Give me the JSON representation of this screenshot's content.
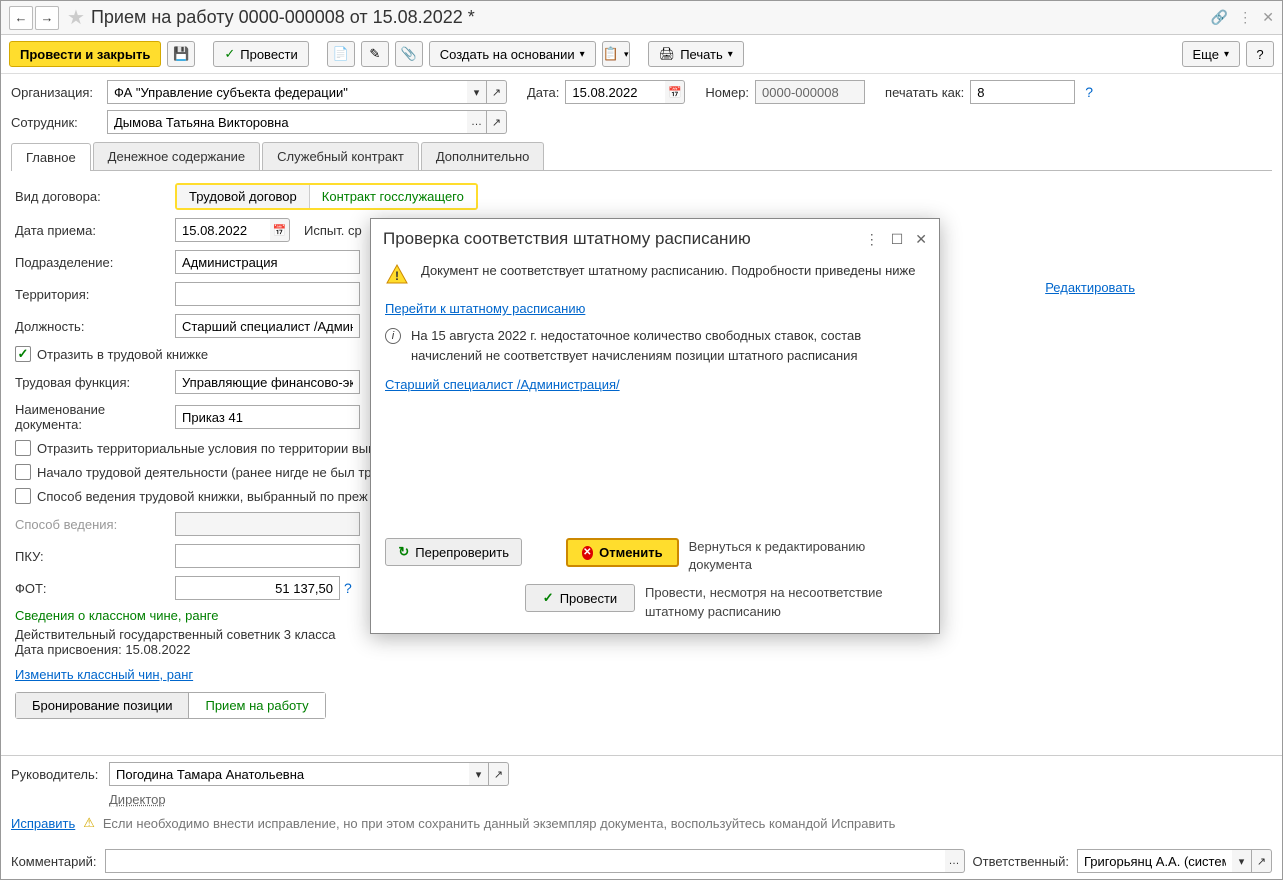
{
  "title": "Прием на работу 0000-000008 от 15.08.2022 *",
  "toolbar": {
    "post_close": "Провести и закрыть",
    "post": "Провести",
    "create_based": "Создать на основании",
    "print": "Печать",
    "more": "Еще",
    "help": "?"
  },
  "header": {
    "org_label": "Организация:",
    "org_value": "ФА \"Управление субъекта федерации\"",
    "date_label": "Дата:",
    "date_value": "15.08.2022",
    "number_label": "Номер:",
    "number_value": "0000-000008",
    "print_as_label": "печатать как:",
    "print_as_value": "8",
    "employee_label": "Сотрудник:",
    "employee_value": "Дымова Татьяна Викторовна"
  },
  "tabs": {
    "main": "Главное",
    "money": "Денежное содержание",
    "contract": "Служебный контракт",
    "extra": "Дополнительно"
  },
  "main_tab": {
    "contract_type_label": "Вид договора:",
    "contract_labor": "Трудовой договор",
    "contract_gov": "Контракт госслужащего",
    "hire_date_label": "Дата приема:",
    "hire_date_value": "15.08.2022",
    "probation_label": "Испыт. ср",
    "department_label": "Подразделение:",
    "department_value": "Администрация",
    "territory_label": "Территория:",
    "position_label": "Должность:",
    "position_value": "Старший специалист /Админис",
    "reflect_workbook": "Отразить в трудовой книжке",
    "labor_func_label": "Трудовая функция:",
    "labor_func_value": "Управляющие финансово-экон",
    "doc_name_label": "Наименование документа:",
    "doc_name_value": "Приказ 41",
    "cb_territorial": "Отразить территориальные условия по территории вып",
    "cb_start_labor": "Начало трудовой деятельности (ранее нигде не был тр",
    "cb_workbook_method": "Способ ведения трудовой книжки, выбранный по преж",
    "method_label": "Способ ведения:",
    "pku_label": "ПКУ:",
    "fot_label": "ФОТ:",
    "fot_value": "51 137,50",
    "rank_title": "Сведения о классном чине, ранге",
    "rank_value": "Действительный государственный советник 3 класса",
    "rank_date_label": "Дата присвоения:",
    "rank_date_value": "15.08.2022",
    "change_rank": "Изменить классный чин, ранг",
    "booking": "Бронирование позиции",
    "hire": "Прием на работу",
    "edit_link": "Редактировать"
  },
  "footer": {
    "manager_label": "Руководитель:",
    "manager_value": "Погодина Тамара Анатольевна",
    "manager_role": "Директор",
    "fix_link": "Исправить",
    "fix_hint": "Если необходимо внести исправление, но при этом сохранить данный экземпляр документа, воспользуйтесь командой Исправить",
    "comment_label": "Комментарий:",
    "responsible_label": "Ответственный:",
    "responsible_value": "Григорьянц А.А. (системн"
  },
  "dialog": {
    "title": "Проверка соответствия штатному расписанию",
    "msg": "Документ не соответствует штатному расписанию. Подробности приведены ниже",
    "goto_schedule": "Перейти к штатному расписанию",
    "info_text": "На 15 августа 2022 г. недостаточное количество свободных ставок, состав начислений не соответствует начислениям позиции штатного расписания",
    "position_link": "Старший специалист /Администрация/",
    "recheck": "Перепроверить",
    "cancel": "Отменить",
    "cancel_hint": "Вернуться к редактированию документа",
    "post": "Провести",
    "post_hint": "Провести, несмотря на несоответствие штатному расписанию"
  }
}
